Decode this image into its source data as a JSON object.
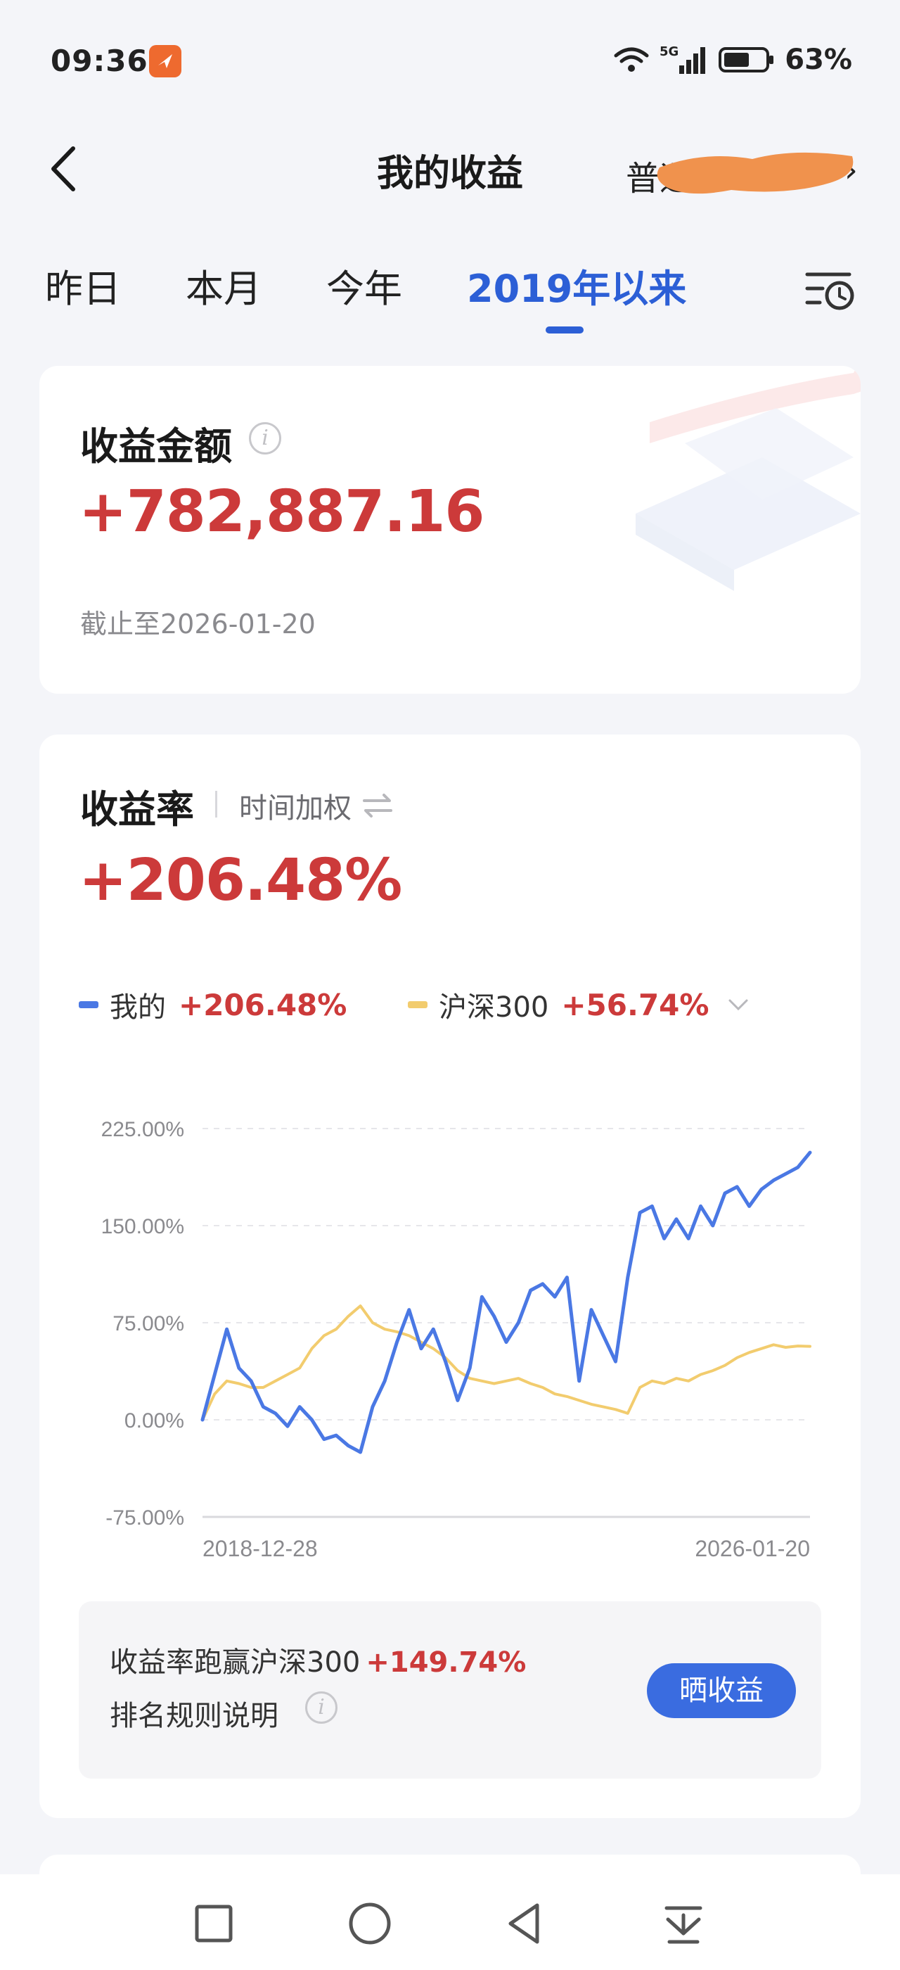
{
  "status_bar": {
    "time": "09:36",
    "network": "5G",
    "battery_pct": "63%",
    "battery_level": 0.63,
    "icons": [
      "app-notification-icon",
      "wifi-icon",
      "signal-5g-icon",
      "battery-icon"
    ]
  },
  "nav": {
    "title": "我的收益",
    "right_text": "普通",
    "back_icon": "chevron-left-icon",
    "right_icon": "chevron-right-icon"
  },
  "tabs": {
    "items": [
      {
        "label": "昨日",
        "active": false
      },
      {
        "label": "本月",
        "active": false
      },
      {
        "label": "今年",
        "active": false
      },
      {
        "label": "2019年以来",
        "active": true
      }
    ],
    "filter_icon": "list-clock-icon"
  },
  "profit_card": {
    "title": "收益金额",
    "amount": "+782,887.16",
    "as_of": "截止至2026-01-20"
  },
  "rate_card": {
    "title": "收益率",
    "mode": "时间加权",
    "rate": "+206.48%",
    "legend": [
      {
        "name": "我的",
        "value": "+206.48%",
        "color": "#4a78e4"
      },
      {
        "name": "沪深300",
        "value": "+56.74%",
        "color": "#f2cc6e"
      }
    ],
    "beat_label": "收益率跑赢沪深300",
    "beat_value": "+149.74%",
    "rank_label": "排名规则说明",
    "share_button": "晒收益"
  },
  "colors": {
    "accent_blue": "#2c5fd6",
    "profit_red": "#cc3a3a",
    "line_mine": "#4a78e4",
    "line_index": "#f2cc6e"
  },
  "chart_data": {
    "type": "line",
    "ylim": [
      -75,
      225
    ],
    "y_ticks": [
      225,
      150,
      75,
      0,
      -75
    ],
    "y_tick_labels": [
      "225.00%",
      "150.00%",
      "75.00%",
      "0.00%",
      "-75.00%"
    ],
    "x_labels": [
      "2018-12-28",
      "2026-01-20"
    ],
    "grid": true,
    "x": [
      0,
      0.02,
      0.04,
      0.06,
      0.08,
      0.1,
      0.12,
      0.14,
      0.16,
      0.18,
      0.2,
      0.22,
      0.24,
      0.26,
      0.28,
      0.3,
      0.32,
      0.34,
      0.36,
      0.38,
      0.4,
      0.42,
      0.44,
      0.46,
      0.48,
      0.5,
      0.52,
      0.54,
      0.56,
      0.58,
      0.6,
      0.62,
      0.64,
      0.66,
      0.68,
      0.7,
      0.72,
      0.74,
      0.76,
      0.78,
      0.8,
      0.82,
      0.84,
      0.86,
      0.88,
      0.9,
      0.92,
      0.94,
      0.96,
      0.98,
      1
    ],
    "series": [
      {
        "name": "我的",
        "color": "#4a78e4",
        "values": [
          0,
          35,
          70,
          40,
          30,
          10,
          5,
          -5,
          10,
          0,
          -15,
          -12,
          -20,
          -25,
          10,
          30,
          60,
          85,
          55,
          70,
          45,
          15,
          40,
          95,
          80,
          60,
          75,
          100,
          105,
          95,
          110,
          30,
          85,
          65,
          45,
          110,
          160,
          165,
          140,
          155,
          140,
          165,
          150,
          175,
          180,
          165,
          178,
          185,
          190,
          195,
          206.48
        ]
      },
      {
        "name": "沪深300",
        "color": "#f2cc6e",
        "values": [
          0,
          20,
          30,
          28,
          25,
          25,
          30,
          35,
          40,
          55,
          65,
          70,
          80,
          88,
          75,
          70,
          68,
          65,
          60,
          55,
          48,
          38,
          32,
          30,
          28,
          30,
          32,
          28,
          25,
          20,
          18,
          15,
          12,
          10,
          8,
          5,
          25,
          30,
          28,
          32,
          30,
          35,
          38,
          42,
          48,
          52,
          55,
          58,
          56,
          57,
          56.74
        ]
      }
    ]
  }
}
